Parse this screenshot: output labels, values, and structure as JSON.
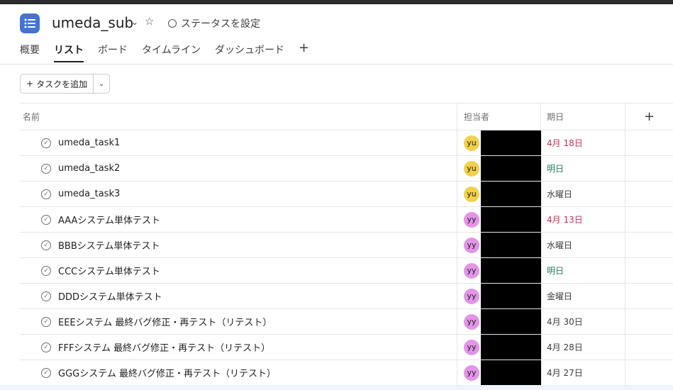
{
  "header": {
    "title": "umeda_sub",
    "status_label": "ステータスを設定",
    "tabs": [
      {
        "label": "概要"
      },
      {
        "label": "リスト",
        "active": true
      },
      {
        "label": "ボード"
      },
      {
        "label": "タイムライン"
      },
      {
        "label": "ダッシュボード"
      }
    ],
    "add_tab_icon": "+"
  },
  "toolbar": {
    "add_task_label": "タスクを追加"
  },
  "table": {
    "columns": {
      "name": "名前",
      "assignee": "担当者",
      "due": "期日",
      "add": "+"
    },
    "rows": [
      {
        "name": "umeda_task1",
        "avatar": "yu",
        "avatar_color": "#f1d04b",
        "due": "4月 18日",
        "due_color": "#c92f54"
      },
      {
        "name": "umeda_task2",
        "avatar": "yu",
        "avatar_color": "#f1d04b",
        "due": "明日",
        "due_color": "#25805c"
      },
      {
        "name": "umeda_task3",
        "avatar": "yu",
        "avatar_color": "#f1d04b",
        "due": "水曜日",
        "due_color": "#3d3e40"
      },
      {
        "name": "AAAシステム単体テスト",
        "avatar": "yy",
        "avatar_color": "#e394e8",
        "due": "4月 13日",
        "due_color": "#c92f54"
      },
      {
        "name": "BBBシステム単体テスト",
        "avatar": "yy",
        "avatar_color": "#e394e8",
        "due": "水曜日",
        "due_color": "#3d3e40"
      },
      {
        "name": "CCCシステム単体テスト",
        "avatar": "yy",
        "avatar_color": "#e394e8",
        "due": "明日",
        "due_color": "#25805c"
      },
      {
        "name": "DDDシステム単体テスト",
        "avatar": "yy",
        "avatar_color": "#e394e8",
        "due": "金曜日",
        "due_color": "#3d3e40"
      },
      {
        "name": "EEEシステム 最終バグ修正・再テスト（リテスト）",
        "avatar": "yy",
        "avatar_color": "#e394e8",
        "due": "4月 30日",
        "due_color": "#3d3e40"
      },
      {
        "name": "FFFシステム 最終バグ修正・再テスト（リテスト）",
        "avatar": "yy",
        "avatar_color": "#e394e8",
        "due": "4月 28日",
        "due_color": "#3d3e40"
      },
      {
        "name": "GGGシステム 最終バグ修正・再テスト（リテスト）",
        "avatar": "yy",
        "avatar_color": "#e394e8",
        "due": "4月 27日",
        "due_color": "#3d3e40"
      }
    ]
  },
  "colors": {
    "accent": "#4573d2"
  }
}
